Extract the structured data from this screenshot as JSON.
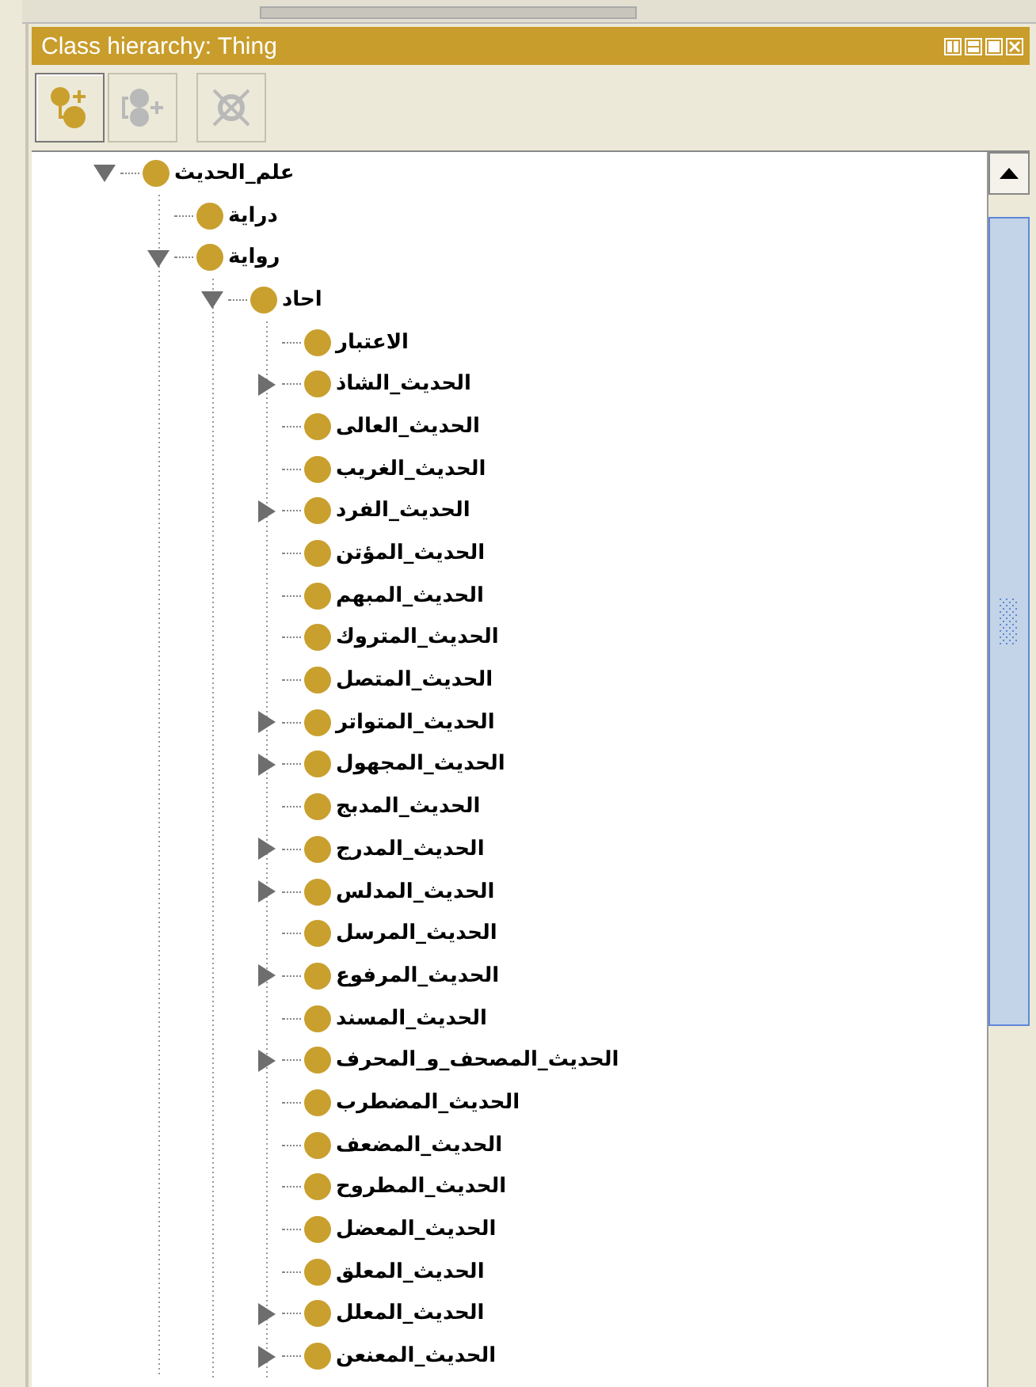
{
  "panel": {
    "title": "Class hierarchy: Thing"
  },
  "toolbar": [
    {
      "kind": "add-subclass",
      "disabled": false
    },
    {
      "kind": "add-sibling",
      "disabled": true
    },
    {
      "kind": "delete",
      "disabled": true
    }
  ],
  "tree": [
    {
      "label": "علم_الحديث",
      "expanded": true,
      "children": [
        {
          "label": "دراية"
        },
        {
          "label": "رواية",
          "expanded": true,
          "children": [
            {
              "label": "احاد",
              "expanded": true,
              "children": [
                {
                  "label": "الاعتبار"
                },
                {
                  "label": "الحديث_الشاذ",
                  "expanded": false
                },
                {
                  "label": "الحديث_العالى"
                },
                {
                  "label": "الحديث_الغريب"
                },
                {
                  "label": "الحديث_الفرد",
                  "expanded": false
                },
                {
                  "label": "الحديث_المؤتن"
                },
                {
                  "label": "الحديث_المبهم"
                },
                {
                  "label": "الحديث_المتروك"
                },
                {
                  "label": "الحديث_المتصل"
                },
                {
                  "label": "الحديث_المتواتر",
                  "expanded": false
                },
                {
                  "label": "الحديث_المجهول",
                  "expanded": false
                },
                {
                  "label": "الحديث_المدبج"
                },
                {
                  "label": "الحديث_المدرج",
                  "expanded": false
                },
                {
                  "label": "الحديث_المدلس",
                  "expanded": false
                },
                {
                  "label": "الحديث_المرسل"
                },
                {
                  "label": "الحديث_المرفوع",
                  "expanded": false
                },
                {
                  "label": "الحديث_المسند"
                },
                {
                  "label": "الحديث_المصحف_و_المحرف",
                  "expanded": false
                },
                {
                  "label": "الحديث_المضطرب"
                },
                {
                  "label": "الحديث_المضعف"
                },
                {
                  "label": "الحديث_المطروح"
                },
                {
                  "label": "الحديث_المعضل"
                },
                {
                  "label": "الحديث_المعلق"
                },
                {
                  "label": "الحديث_المعلل",
                  "expanded": false
                },
                {
                  "label": "الحديث_المعنعن",
                  "expanded": false
                }
              ]
            }
          ]
        }
      ]
    }
  ]
}
